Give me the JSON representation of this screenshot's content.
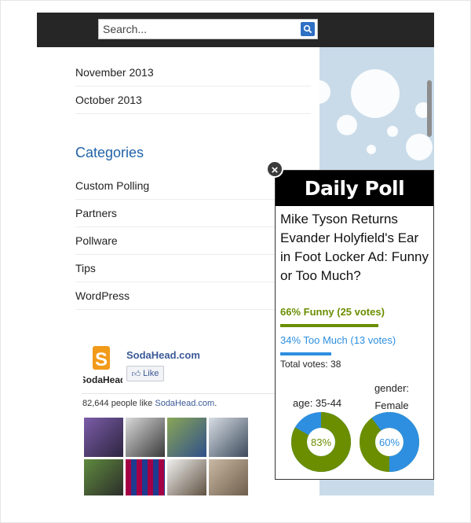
{
  "search": {
    "placeholder": "Search..."
  },
  "archives": [
    "November 2013",
    "October 2013"
  ],
  "categories": {
    "title": "Categories",
    "items": [
      "Custom Polling",
      "Partners",
      "Pollware",
      "Tips",
      "WordPress"
    ]
  },
  "facebook": {
    "page_name": "SodaHead.com",
    "like_label": "Like",
    "count_text": "82,644 people like ",
    "count_link": "SodaHead.com",
    "count_suffix": ".",
    "logo_text": "SodaHead"
  },
  "poll": {
    "close_label": "×",
    "header": "Daily Poll",
    "question": "Mike Tyson Returns Evander Holyfield's Ear in Foot Locker Ad: Funny or Too Much?",
    "results": [
      {
        "label": "66% Funny (25 votes)",
        "percent": 66,
        "color": "#6b8e00"
      },
      {
        "label": "34% Too Much (13 votes)",
        "percent": 34,
        "color": "#2e8fe0"
      }
    ],
    "total_votes": "Total votes: 38",
    "age_label": "age: 35-44",
    "age_value": 83,
    "age_text": "83%",
    "gender_label": "gender:",
    "gender_value_label": "Female",
    "gender_value": 60,
    "gender_text": "60%"
  },
  "colors": {
    "topbar": "#262626",
    "accent_blue": "#2063a8",
    "green": "#6b8e00",
    "blue": "#2e8fe0"
  }
}
